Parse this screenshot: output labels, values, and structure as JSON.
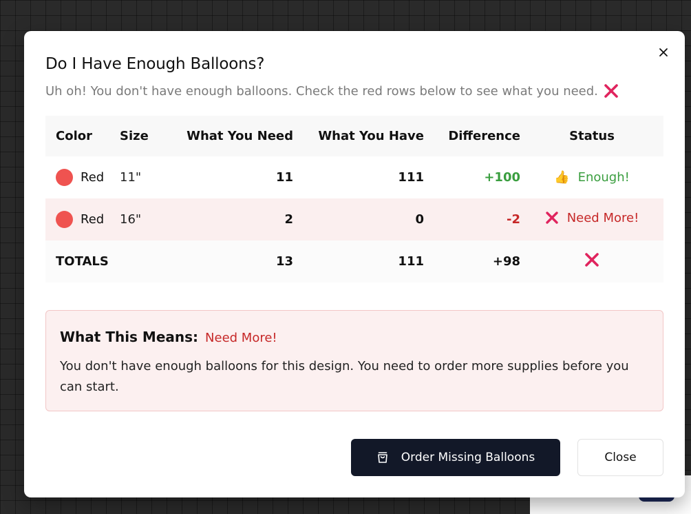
{
  "dialog": {
    "title": "Do I Have Enough Balloons?",
    "subtitle": "Uh oh! You don't have enough balloons. Check the red rows below to see what you need.",
    "status_icon": "cross-mark-icon"
  },
  "table": {
    "headers": {
      "color": "Color",
      "size": "Size",
      "need": "What You Need",
      "have": "What You Have",
      "difference": "Difference",
      "status": "Status"
    },
    "rows": [
      {
        "color": "Red",
        "color_hex": "#ef5350",
        "size": "11\"",
        "need": "11",
        "have": "111",
        "difference": "+100",
        "status": "Enough!",
        "status_icon": "thumbs-up-icon",
        "state": "ok"
      },
      {
        "color": "Red",
        "color_hex": "#ef5350",
        "size": "16\"",
        "need": "2",
        "have": "0",
        "difference": "-2",
        "status": "Need More!",
        "status_icon": "cross-mark-icon",
        "state": "short"
      }
    ],
    "totals": {
      "label": "TOTALS",
      "need": "13",
      "have": "111",
      "difference": "+98",
      "status_icon": "cross-mark-icon"
    }
  },
  "summary": {
    "title": "What This Means:",
    "badge": "Need More!",
    "text": "You don't have enough balloons for this design. You need to order more supplies before you can start."
  },
  "actions": {
    "order_label": "Order Missing Balloons",
    "order_icon": "shopping-bag-icon",
    "close_label": "Close"
  },
  "colors": {
    "ok": "#3a9e3f",
    "short": "#c62828",
    "cross": "#e0245e",
    "short_row_bg": "#fbefef",
    "primary_button": "#121828"
  }
}
